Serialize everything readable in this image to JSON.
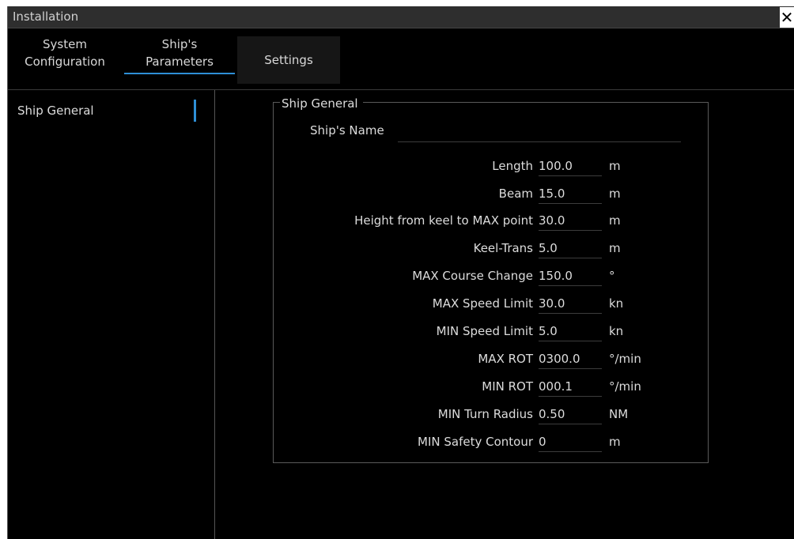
{
  "window": {
    "title": "Installation",
    "close_glyph": "✕"
  },
  "tabs": [
    {
      "label": "System\nConfiguration"
    },
    {
      "label": "Ship's\nParameters"
    },
    {
      "label": "Settings"
    }
  ],
  "sidebar": {
    "items": [
      {
        "label": "Ship General"
      }
    ]
  },
  "group": {
    "title": "Ship General",
    "ship_name_label": "Ship's Name",
    "ship_name_value": "",
    "rows": [
      {
        "label": "Length",
        "value": "100.0",
        "unit": "m"
      },
      {
        "label": "Beam",
        "value": "15.0",
        "unit": "m"
      },
      {
        "label": "Height from keel to MAX point",
        "value": "30.0",
        "unit": "m"
      },
      {
        "label": "Keel-Trans",
        "value": "5.0",
        "unit": "m"
      },
      {
        "label": "MAX Course Change",
        "value": "150.0",
        "unit": "°"
      },
      {
        "label": "MAX Speed Limit",
        "value": "30.0",
        "unit": "kn"
      },
      {
        "label": "MIN Speed Limit",
        "value": "5.0",
        "unit": "kn"
      },
      {
        "label": "MAX ROT",
        "value": "0300.0",
        "unit": "°/min"
      },
      {
        "label": "MIN ROT",
        "value": "000.1",
        "unit": "°/min"
      },
      {
        "label": "MIN Turn Radius",
        "value": "0.50",
        "unit": "NM"
      },
      {
        "label": "MIN Safety Contour",
        "value": "0",
        "unit": "m"
      }
    ]
  },
  "colors": {
    "accent": "#2e8fd6",
    "background": "#000000",
    "text": "#dcdcdc"
  }
}
